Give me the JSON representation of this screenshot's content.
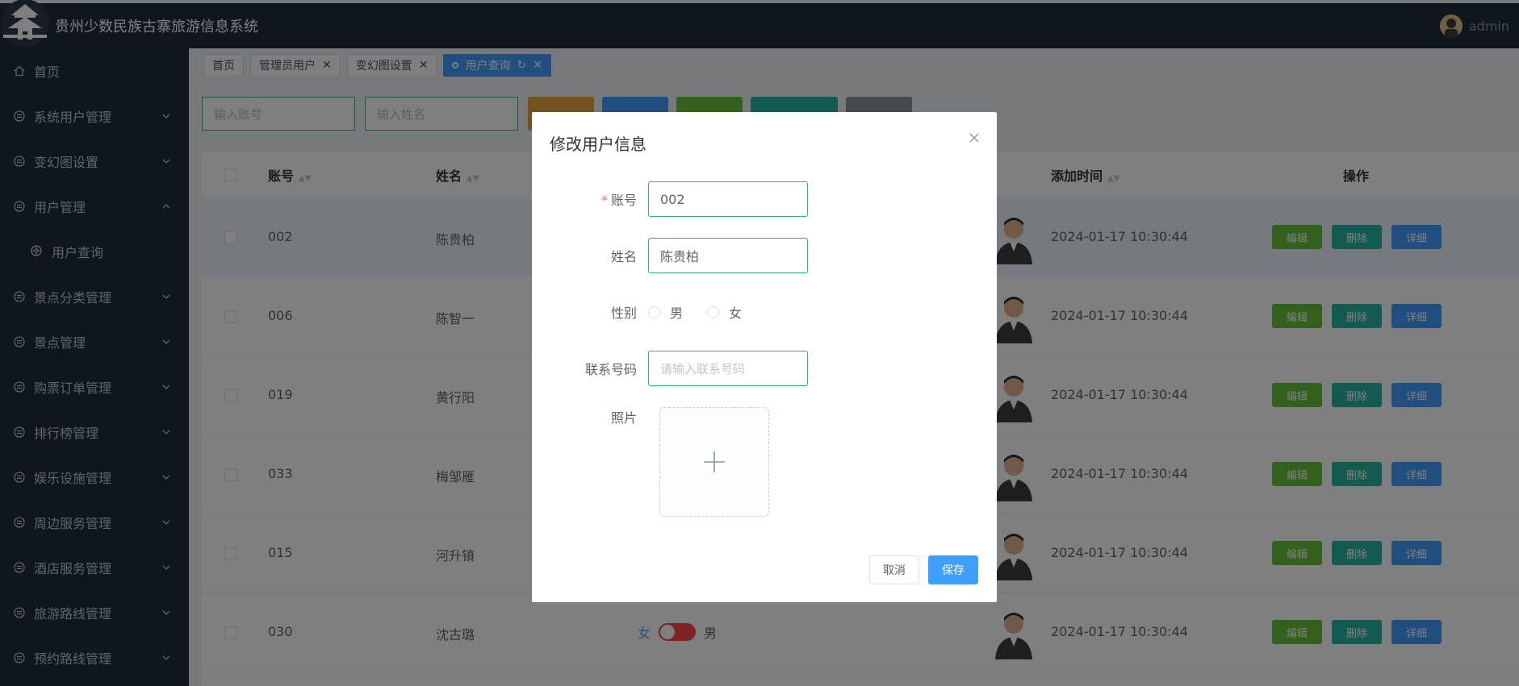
{
  "header": {
    "title": "贵州少数民族古寨旅游信息系统",
    "user": "admin"
  },
  "sidebar": {
    "items": [
      {
        "label": "首页",
        "icon": "home-icon"
      },
      {
        "label": "系统用户管理",
        "icon": "menu-icon"
      },
      {
        "label": "变幻图设置",
        "icon": "menu-icon"
      },
      {
        "label": "用户管理",
        "icon": "menu-icon",
        "expanded": true
      },
      {
        "label": "用户查询",
        "icon": "gear-icon",
        "sub": true
      },
      {
        "label": "景点分类管理",
        "icon": "menu-icon"
      },
      {
        "label": "景点管理",
        "icon": "menu-icon"
      },
      {
        "label": "购票订单管理",
        "icon": "menu-icon"
      },
      {
        "label": "排行榜管理",
        "icon": "menu-icon"
      },
      {
        "label": "娱乐设施管理",
        "icon": "menu-icon"
      },
      {
        "label": "周边服务管理",
        "icon": "menu-icon"
      },
      {
        "label": "酒店服务管理",
        "icon": "menu-icon"
      },
      {
        "label": "旅游路线管理",
        "icon": "menu-icon"
      },
      {
        "label": "预约路线管理",
        "icon": "menu-icon"
      }
    ]
  },
  "tags": [
    {
      "label": "首页"
    },
    {
      "label": "管理员用户"
    },
    {
      "label": "变幻图设置"
    },
    {
      "label": "用户查询",
      "active": true
    }
  ],
  "search": {
    "account_placeholder": "输入账号",
    "name_placeholder": "输入姓名"
  },
  "table": {
    "headers": {
      "account": "账号",
      "name": "姓名",
      "time": "添加时间",
      "ops": "操作"
    },
    "rows": [
      {
        "account": "002",
        "name": "陈贵柏",
        "time": "2024-01-17 10:30:44"
      },
      {
        "account": "006",
        "name": "陈智一",
        "time": "2024-01-17 10:30:44"
      },
      {
        "account": "019",
        "name": "黄行阳",
        "time": "2024-01-17 10:30:44"
      },
      {
        "account": "033",
        "name": "梅邹雁",
        "time": "2024-01-17 10:30:44"
      },
      {
        "account": "015",
        "name": "河升镇",
        "time": "2024-01-17 10:30:44"
      },
      {
        "account": "030",
        "name": "沈古璐",
        "time": "2024-01-17 10:30:44"
      }
    ],
    "ops": {
      "edit": "编辑",
      "delete": "删除",
      "detail": "详细"
    },
    "gender_toggle": {
      "left": "女",
      "right": "男"
    }
  },
  "dialog": {
    "title": "修改用户信息",
    "account_label": "账号",
    "account_value": "002",
    "name_label": "姓名",
    "name_value": "陈贵柏",
    "gender_label": "性别",
    "gender_male": "男",
    "gender_female": "女",
    "phone_label": "联系号码",
    "phone_placeholder": "请输入联系号码",
    "photo_label": "照片",
    "cancel": "取消",
    "save": "保存"
  },
  "colors": {
    "primary": "#409eff",
    "success": "#67c23a",
    "teal": "#26b5a1",
    "warning": "#e6a23c",
    "sidebar": "#1f2d3d"
  }
}
